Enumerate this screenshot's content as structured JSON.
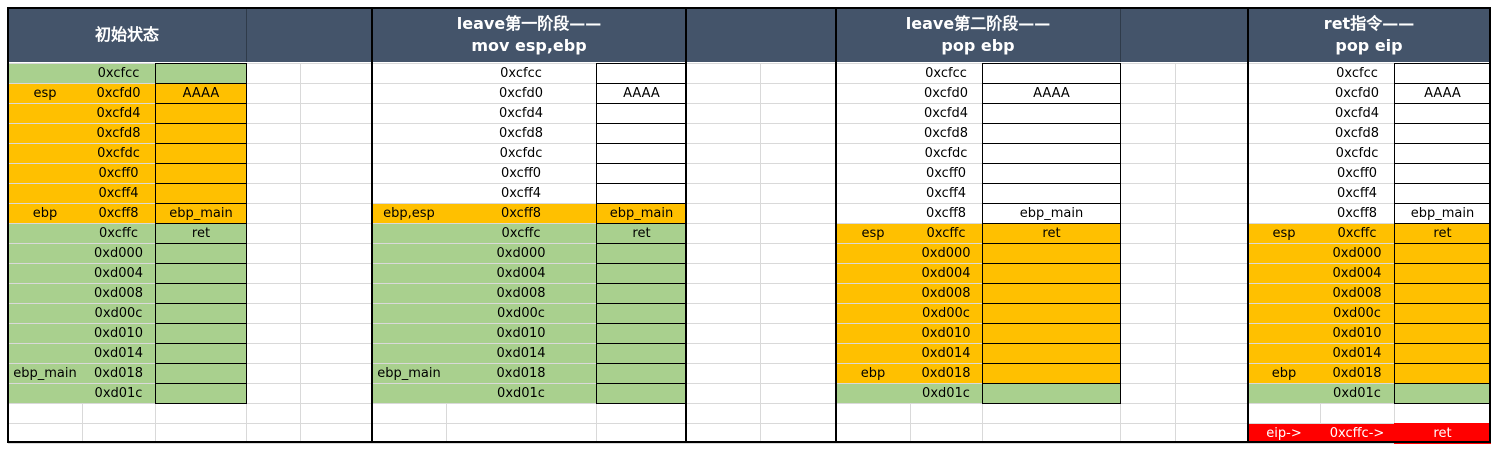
{
  "colors": {
    "header": "#44546a",
    "green": "#a9d08e",
    "orange": "#ffc000",
    "red": "#ff0000"
  },
  "panels": [
    {
      "title_lines": [
        "初始状态"
      ],
      "rows": [
        {
          "reg": "",
          "addr": "0xcfcc",
          "val": "",
          "color": "green"
        },
        {
          "reg": "esp",
          "addr": "0xcfd0",
          "val": "AAAA",
          "color": "orange"
        },
        {
          "reg": "",
          "addr": "0xcfd4",
          "val": "",
          "color": "orange"
        },
        {
          "reg": "",
          "addr": "0xcfd8",
          "val": "",
          "color": "orange"
        },
        {
          "reg": "",
          "addr": "0xcfdc",
          "val": "",
          "color": "orange"
        },
        {
          "reg": "",
          "addr": "0xcff0",
          "val": "",
          "color": "orange"
        },
        {
          "reg": "",
          "addr": "0xcff4",
          "val": "",
          "color": "orange"
        },
        {
          "reg": "ebp",
          "addr": "0xcff8",
          "val": "ebp_main",
          "color": "orange"
        },
        {
          "reg": "",
          "addr": "0xcffc",
          "val": "ret",
          "color": "green"
        },
        {
          "reg": "",
          "addr": "0xd000",
          "val": "",
          "color": "green"
        },
        {
          "reg": "",
          "addr": "0xd004",
          "val": "",
          "color": "green"
        },
        {
          "reg": "",
          "addr": "0xd008",
          "val": "",
          "color": "green"
        },
        {
          "reg": "",
          "addr": "0xd00c",
          "val": "",
          "color": "green"
        },
        {
          "reg": "",
          "addr": "0xd010",
          "val": "",
          "color": "green"
        },
        {
          "reg": "",
          "addr": "0xd014",
          "val": "",
          "color": "green"
        },
        {
          "reg": "ebp_main",
          "addr": "0xd018",
          "val": "",
          "color": "green"
        },
        {
          "reg": "",
          "addr": "0xd01c",
          "val": "",
          "color": "green"
        }
      ]
    },
    {
      "title_lines": [
        "leave第一阶段——",
        "mov esp,ebp"
      ],
      "rows": [
        {
          "reg": "",
          "addr": "0xcfcc",
          "val": "",
          "color": "white"
        },
        {
          "reg": "",
          "addr": "0xcfd0",
          "val": "AAAA",
          "color": "white"
        },
        {
          "reg": "",
          "addr": "0xcfd4",
          "val": "",
          "color": "white"
        },
        {
          "reg": "",
          "addr": "0xcfd8",
          "val": "",
          "color": "white"
        },
        {
          "reg": "",
          "addr": "0xcfdc",
          "val": "",
          "color": "white"
        },
        {
          "reg": "",
          "addr": "0xcff0",
          "val": "",
          "color": "white"
        },
        {
          "reg": "",
          "addr": "0xcff4",
          "val": "",
          "color": "white"
        },
        {
          "reg": "ebp,esp",
          "addr": "0xcff8",
          "val": "ebp_main",
          "color": "orange"
        },
        {
          "reg": "",
          "addr": "0xcffc",
          "val": "ret",
          "color": "green"
        },
        {
          "reg": "",
          "addr": "0xd000",
          "val": "",
          "color": "green"
        },
        {
          "reg": "",
          "addr": "0xd004",
          "val": "",
          "color": "green"
        },
        {
          "reg": "",
          "addr": "0xd008",
          "val": "",
          "color": "green"
        },
        {
          "reg": "",
          "addr": "0xd00c",
          "val": "",
          "color": "green"
        },
        {
          "reg": "",
          "addr": "0xd010",
          "val": "",
          "color": "green"
        },
        {
          "reg": "",
          "addr": "0xd014",
          "val": "",
          "color": "green"
        },
        {
          "reg": "ebp_main",
          "addr": "0xd018",
          "val": "",
          "color": "green"
        },
        {
          "reg": "",
          "addr": "0xd01c",
          "val": "",
          "color": "green"
        }
      ]
    },
    {
      "title_lines": [
        "leave第二阶段——",
        "pop ebp"
      ],
      "rows": [
        {
          "reg": "",
          "addr": "0xcfcc",
          "val": "",
          "color": "white"
        },
        {
          "reg": "",
          "addr": "0xcfd0",
          "val": "AAAA",
          "color": "white"
        },
        {
          "reg": "",
          "addr": "0xcfd4",
          "val": "",
          "color": "white"
        },
        {
          "reg": "",
          "addr": "0xcfd8",
          "val": "",
          "color": "white"
        },
        {
          "reg": "",
          "addr": "0xcfdc",
          "val": "",
          "color": "white"
        },
        {
          "reg": "",
          "addr": "0xcff0",
          "val": "",
          "color": "white"
        },
        {
          "reg": "",
          "addr": "0xcff4",
          "val": "",
          "color": "white"
        },
        {
          "reg": "",
          "addr": "0xcff8",
          "val": "ebp_main",
          "color": "white"
        },
        {
          "reg": "esp",
          "addr": "0xcffc",
          "val": "ret",
          "color": "orange"
        },
        {
          "reg": "",
          "addr": "0xd000",
          "val": "",
          "color": "orange"
        },
        {
          "reg": "",
          "addr": "0xd004",
          "val": "",
          "color": "orange"
        },
        {
          "reg": "",
          "addr": "0xd008",
          "val": "",
          "color": "orange"
        },
        {
          "reg": "",
          "addr": "0xd00c",
          "val": "",
          "color": "orange"
        },
        {
          "reg": "",
          "addr": "0xd010",
          "val": "",
          "color": "orange"
        },
        {
          "reg": "",
          "addr": "0xd014",
          "val": "",
          "color": "orange"
        },
        {
          "reg": "ebp",
          "addr": "0xd018",
          "val": "",
          "color": "orange"
        },
        {
          "reg": "",
          "addr": "0xd01c",
          "val": "",
          "color": "green"
        }
      ]
    },
    {
      "title_lines": [
        "ret指令——",
        "pop eip"
      ],
      "rows": [
        {
          "reg": "",
          "addr": "0xcfcc",
          "val": "",
          "color": "white"
        },
        {
          "reg": "",
          "addr": "0xcfd0",
          "val": "AAAA",
          "color": "white"
        },
        {
          "reg": "",
          "addr": "0xcfd4",
          "val": "",
          "color": "white"
        },
        {
          "reg": "",
          "addr": "0xcfd8",
          "val": "",
          "color": "white"
        },
        {
          "reg": "",
          "addr": "0xcfdc",
          "val": "",
          "color": "white"
        },
        {
          "reg": "",
          "addr": "0xcff0",
          "val": "",
          "color": "white"
        },
        {
          "reg": "",
          "addr": "0xcff4",
          "val": "",
          "color": "white"
        },
        {
          "reg": "",
          "addr": "0xcff8",
          "val": "ebp_main",
          "color": "white"
        },
        {
          "reg": "esp",
          "addr": "0xcffc",
          "val": "ret",
          "color": "orange"
        },
        {
          "reg": "",
          "addr": "0xd000",
          "val": "",
          "color": "orange"
        },
        {
          "reg": "",
          "addr": "0xd004",
          "val": "",
          "color": "orange"
        },
        {
          "reg": "",
          "addr": "0xd008",
          "val": "",
          "color": "orange"
        },
        {
          "reg": "",
          "addr": "0xd00c",
          "val": "",
          "color": "orange"
        },
        {
          "reg": "",
          "addr": "0xd010",
          "val": "",
          "color": "orange"
        },
        {
          "reg": "",
          "addr": "0xd014",
          "val": "",
          "color": "orange"
        },
        {
          "reg": "ebp",
          "addr": "0xd018",
          "val": "",
          "color": "orange"
        },
        {
          "reg": "",
          "addr": "0xd01c",
          "val": "",
          "color": "green"
        }
      ],
      "eip_row": {
        "reg": "eip->",
        "addr": "0xcffc->",
        "val": "ret",
        "color": "red"
      }
    }
  ]
}
